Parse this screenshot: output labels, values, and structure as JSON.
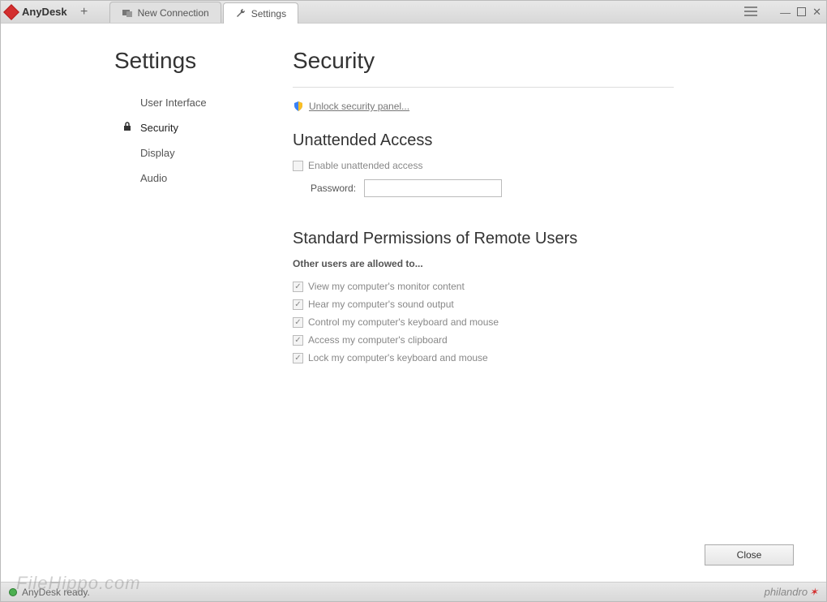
{
  "app": {
    "name": "AnyDesk"
  },
  "tabs": {
    "t0": {
      "label": "New Connection"
    },
    "t1": {
      "label": "Settings"
    }
  },
  "sidebar": {
    "heading": "Settings",
    "items": {
      "ui": "User Interface",
      "security": "Security",
      "display": "Display",
      "audio": "Audio"
    }
  },
  "page": {
    "title": "Security",
    "unlock_link": "Unlock security panel...",
    "section_unattended": {
      "title": "Unattended Access",
      "enable_label": "Enable unattended access",
      "password_label": "Password:",
      "password_value": ""
    },
    "section_perms": {
      "title": "Standard Permissions of Remote Users",
      "subtext": "Other users are allowed to...",
      "items": {
        "p0": "View my computer's monitor content",
        "p1": "Hear my computer's sound output",
        "p2": "Control my computer's keyboard and mouse",
        "p3": "Access my computer's clipboard",
        "p4": "Lock my computer's keyboard and mouse"
      }
    }
  },
  "buttons": {
    "close": "Close"
  },
  "status": {
    "text": "AnyDesk ready."
  },
  "brand": "philandro",
  "watermark": "FileHippo.com"
}
